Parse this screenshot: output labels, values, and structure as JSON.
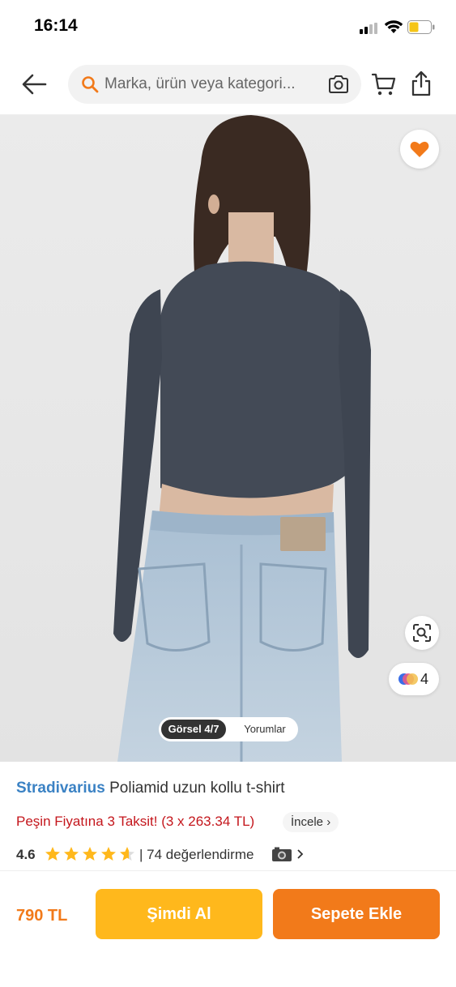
{
  "status_bar": {
    "time": "16:14"
  },
  "search": {
    "placeholder": "Marka, ürün veya kategori..."
  },
  "image_gallery": {
    "active_tab": "Görsel 4/7",
    "reviews_tab": "Yorumlar",
    "variant_count": "4"
  },
  "product": {
    "brand": "Stradivarius",
    "name": "Poliamid uzun kollu t-shirt",
    "installment_text": "Peşin Fiyatına 3 Taksit! (3 x 263.34 TL)",
    "installment_link": "İncele",
    "rating": "4.6",
    "rating_stars": 4.6,
    "rating_count": "| 74 değerlendirme"
  },
  "bottom_bar": {
    "price": "790 TL",
    "buy_now": "Şimdi Al",
    "add_to_cart": "Sepete Ekle"
  },
  "colors": {
    "accent": "#f27a1a",
    "buy_now": "#ffb81c",
    "brand_link": "#3b82c4",
    "installment": "#c4161c"
  }
}
